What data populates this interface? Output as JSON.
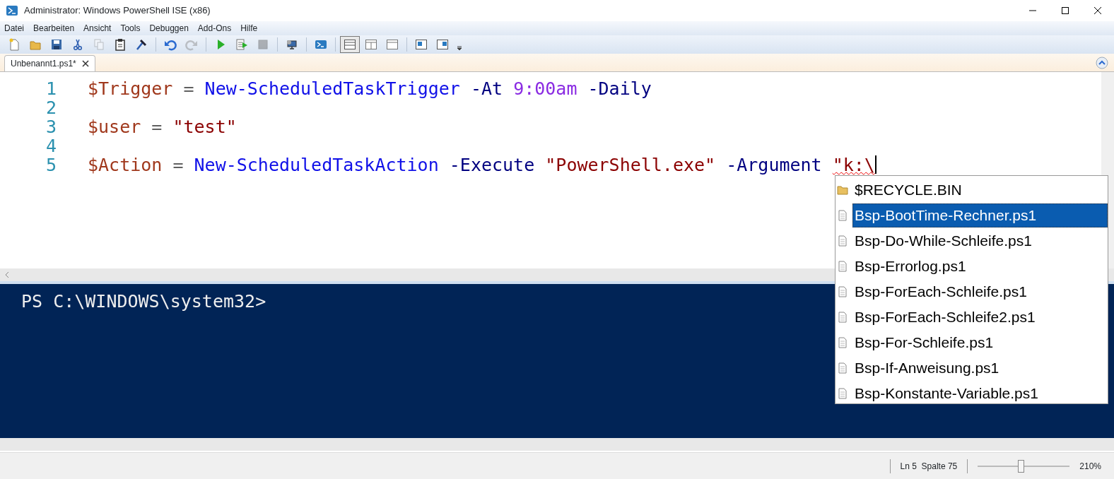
{
  "window": {
    "title": "Administrator: Windows PowerShell ISE (x86)"
  },
  "menu": [
    "Datei",
    "Bearbeiten",
    "Ansicht",
    "Tools",
    "Debuggen",
    "Add-Ons",
    "Hilfe"
  ],
  "toolbar": [
    {
      "kind": "new",
      "disabled": false
    },
    {
      "kind": "open",
      "disabled": false
    },
    {
      "kind": "save",
      "disabled": false
    },
    {
      "kind": "cut",
      "disabled": false
    },
    {
      "kind": "copy",
      "disabled": true
    },
    {
      "kind": "paste",
      "disabled": false
    },
    {
      "kind": "clear",
      "disabled": false
    },
    {
      "kind": "sep"
    },
    {
      "kind": "undo",
      "disabled": false
    },
    {
      "kind": "redo",
      "disabled": true
    },
    {
      "kind": "sep"
    },
    {
      "kind": "run",
      "disabled": false
    },
    {
      "kind": "runsel",
      "disabled": false
    },
    {
      "kind": "stop",
      "disabled": true
    },
    {
      "kind": "sep"
    },
    {
      "kind": "remote",
      "disabled": false
    },
    {
      "kind": "sep"
    },
    {
      "kind": "shell",
      "disabled": false
    },
    {
      "kind": "sep"
    },
    {
      "kind": "layout-top",
      "selected": true
    },
    {
      "kind": "layout-right",
      "selected": false
    },
    {
      "kind": "layout-max",
      "selected": false
    },
    {
      "kind": "sep"
    },
    {
      "kind": "show-script",
      "disabled": false
    },
    {
      "kind": "show-script-right",
      "disabled": false
    }
  ],
  "tabs": [
    {
      "label": "Unbenannt1.ps1*",
      "selected": true
    }
  ],
  "editor": {
    "lines": [
      {
        "number": "1",
        "tokens": [
          {
            "kind": "variable",
            "text": "$Trigger",
            "error": false
          },
          {
            "kind": "operator",
            "text": "=",
            "error": false
          },
          {
            "kind": "command",
            "text": "New-ScheduledTaskTrigger",
            "error": false
          },
          {
            "kind": "parameter",
            "text": "-At",
            "error": false
          },
          {
            "kind": "number",
            "text": "9:00am",
            "error": false
          },
          {
            "kind": "parameter",
            "text": "-Daily",
            "error": false
          }
        ]
      },
      {
        "number": "2"
      },
      {
        "number": "3",
        "tokens": [
          {
            "kind": "variable",
            "text": "$user",
            "error": false
          },
          {
            "kind": "operator",
            "text": "=",
            "error": false
          },
          {
            "kind": "string",
            "text": "\"test\"",
            "error": false
          }
        ]
      },
      {
        "number": "4"
      },
      {
        "number": "5",
        "tokens": [
          {
            "kind": "variable",
            "text": "$Action",
            "error": false
          },
          {
            "kind": "operator",
            "text": "=",
            "error": false
          },
          {
            "kind": "command",
            "text": "New-ScheduledTaskAction",
            "error": false
          },
          {
            "kind": "parameter",
            "text": "-Execute",
            "error": false
          },
          {
            "kind": "string",
            "text": "\"PowerShell.exe\"",
            "error": false
          },
          {
            "kind": "parameter",
            "text": "-Argument",
            "error": false
          },
          {
            "kind": "string",
            "text": "\"k:\\",
            "error": true
          }
        ],
        "caret": true
      }
    ]
  },
  "autocomplete": {
    "items": [
      {
        "kind": "folder",
        "label": "$RECYCLE.BIN",
        "selected": false
      },
      {
        "kind": "file",
        "label": "Bsp-BootTime-Rechner.ps1",
        "selected": true
      },
      {
        "kind": "file",
        "label": "Bsp-Do-While-Schleife.ps1",
        "selected": false
      },
      {
        "kind": "file",
        "label": "Bsp-Errorlog.ps1",
        "selected": false
      },
      {
        "kind": "file",
        "label": "Bsp-ForEach-Schleife.ps1",
        "selected": false
      },
      {
        "kind": "file",
        "label": "Bsp-ForEach-Schleife2.ps1",
        "selected": false
      },
      {
        "kind": "file",
        "label": "Bsp-For-Schleife.ps1",
        "selected": false
      },
      {
        "kind": "file",
        "label": "Bsp-If-Anweisung.ps1",
        "selected": false
      },
      {
        "kind": "file",
        "label": "Bsp-Konstante-Variable.ps1",
        "selected": false
      }
    ]
  },
  "console": {
    "prompt": "PS C:\\WINDOWS\\system32>"
  },
  "status_bar": {
    "position": "Ln 5  Spalte 75",
    "zoom": "210%",
    "zoom_slider": {
      "level": 0.47
    }
  }
}
